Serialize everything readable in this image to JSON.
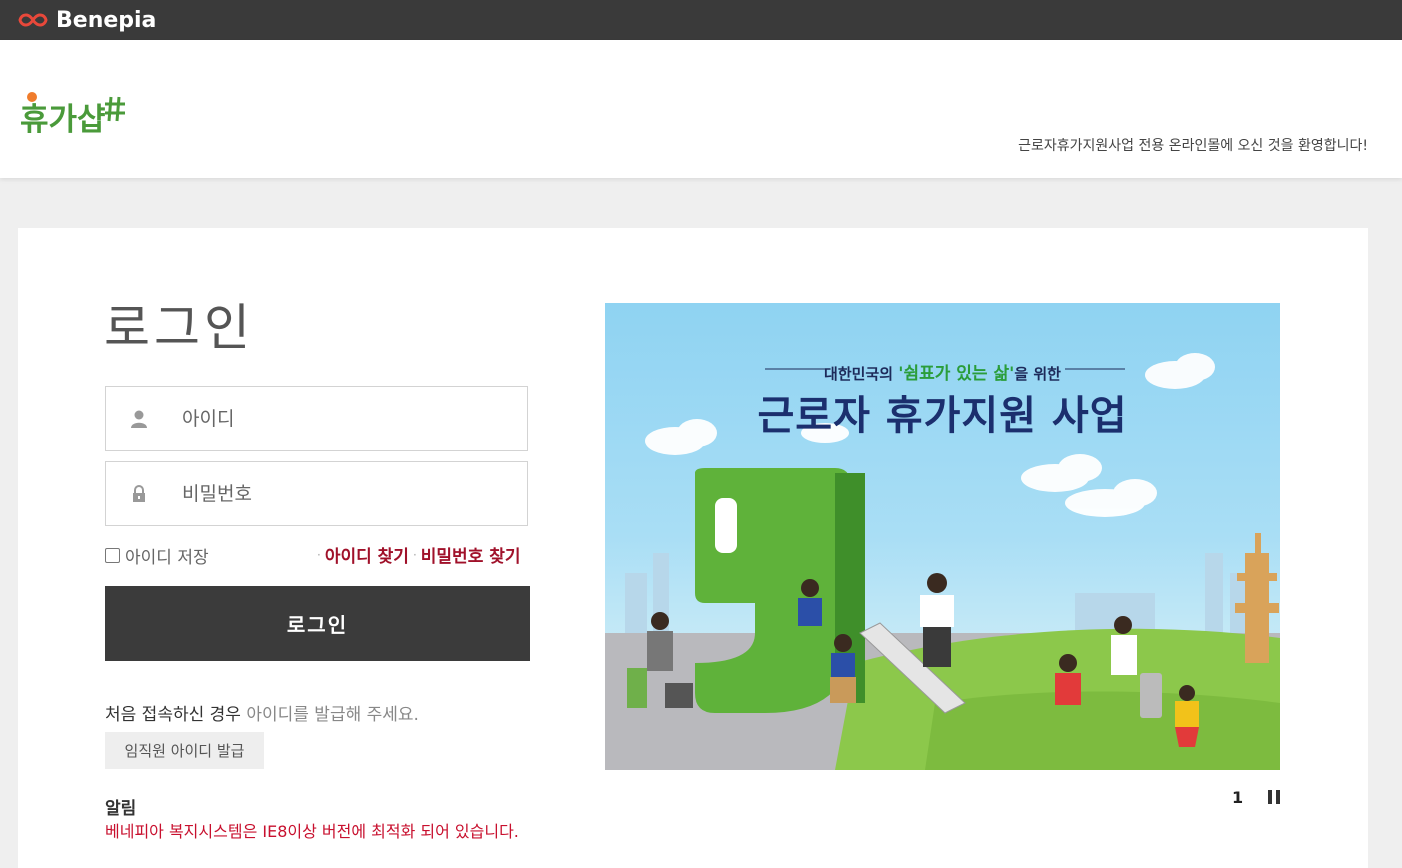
{
  "topbar": {
    "brand": "Benepia",
    "brand_color": "#e8483a"
  },
  "header": {
    "logo_text": "휴가샵",
    "logo_color": "#4a9a3a",
    "welcome": "근로자휴가지원사업 전용 온라인몰에 오신 것을 환영합니다!"
  },
  "login": {
    "title": "로그인",
    "id_placeholder": "아이디",
    "pw_placeholder": "비밀번호",
    "save_id_label": "아이디 저장",
    "find_id": "아이디 찾기",
    "find_pw": "비밀번호 찾기",
    "submit": "로그인",
    "first_visit_a": "처음 접속하신 경우 ",
    "first_visit_b": "아이디를 발급해 주세요.",
    "issue_button": "임직원 아이디 발급",
    "notice_title": "알림",
    "notice_text": "베네피아 복지시스템은 IE8이상 버전에 최적화 되어 있습니다.",
    "accent_color": "#a0112a"
  },
  "banner": {
    "sub_a": "대한민국의 ",
    "sub_hl": "'쉼표가 있는 삶'",
    "sub_b": "을 위한",
    "title": "근로자 휴가지원 사업",
    "page": "1"
  },
  "icons": {
    "brand": "infinity-icon",
    "user": "user-icon",
    "lock": "lock-icon",
    "pause": "pause-icon"
  }
}
